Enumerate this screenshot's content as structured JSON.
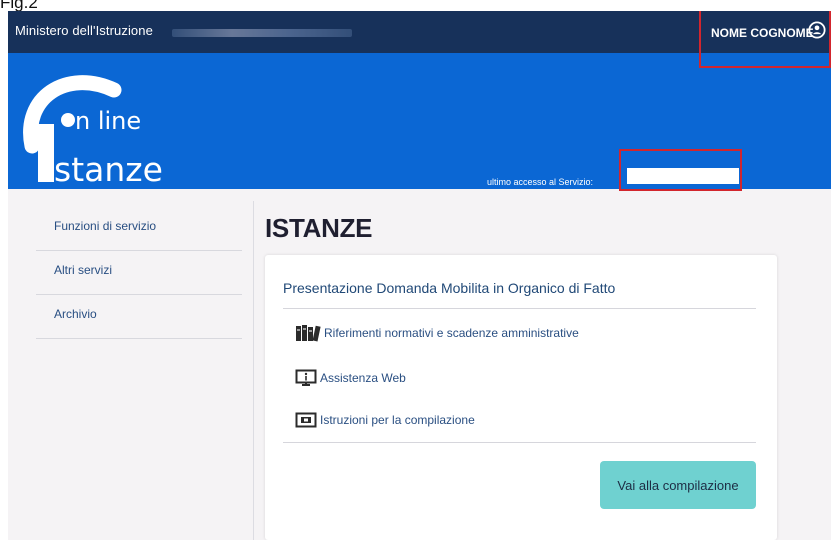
{
  "figure": {
    "label": "Fig.2"
  },
  "header": {
    "ministry": "Ministero dell'Istruzione",
    "user_name": "NOME COGNOME"
  },
  "banner": {
    "logo_line1": "n line",
    "logo_line2": "stanze",
    "last_access_label": "ultimo accesso al Servizio:",
    "last_access_value": ""
  },
  "sidebar": {
    "items": [
      {
        "label": "Funzioni di servizio"
      },
      {
        "label": "Altri servizi"
      },
      {
        "label": "Archivio"
      }
    ]
  },
  "main": {
    "title": "ISTANZE",
    "card": {
      "title": "Presentazione Domanda Mobilita in Organico di Fatto",
      "links": [
        {
          "label": "Riferimenti normativi e scadenze amministrative",
          "icon": "books-icon"
        },
        {
          "label": "Assistenza Web",
          "icon": "monitor-help-icon"
        },
        {
          "label": "Istruzioni per la compilazione",
          "icon": "screen-instructions-icon"
        }
      ],
      "button": "Vai alla compilazione"
    }
  },
  "colors": {
    "topbar": "#17315a",
    "banner": "#0b67d4",
    "button": "#6fd1d0",
    "highlight": "#d2252d",
    "link": "#2a4f82"
  }
}
